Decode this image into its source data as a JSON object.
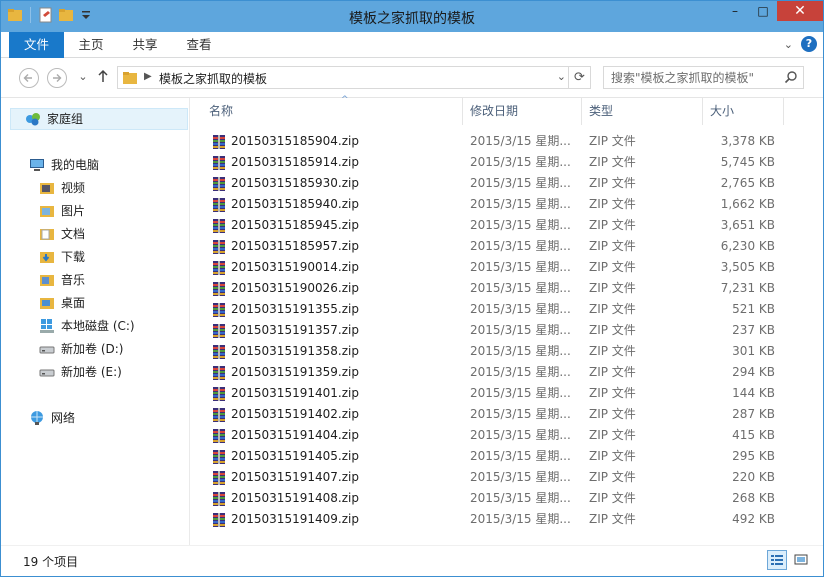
{
  "window": {
    "title": "模板之家抓取的模板",
    "minimize": "–",
    "maximize": "□",
    "close": "✕"
  },
  "ribbon": {
    "tabs": [
      {
        "label": "文件"
      },
      {
        "label": "主页"
      },
      {
        "label": "共享"
      },
      {
        "label": "查看"
      }
    ],
    "help": "?"
  },
  "address": {
    "path": "模板之家抓取的模板"
  },
  "search": {
    "placeholder": "搜索\"模板之家抓取的模板\""
  },
  "nav": {
    "homegroup": "家庭组",
    "computer": "我的电脑",
    "items": [
      {
        "label": "视频",
        "icon": "video-folder-icon"
      },
      {
        "label": "图片",
        "icon": "pictures-folder-icon"
      },
      {
        "label": "文档",
        "icon": "documents-folder-icon"
      },
      {
        "label": "下载",
        "icon": "downloads-folder-icon"
      },
      {
        "label": "音乐",
        "icon": "music-folder-icon"
      },
      {
        "label": "桌面",
        "icon": "desktop-folder-icon"
      },
      {
        "label": "本地磁盘 (C:)",
        "icon": "system-drive-icon"
      },
      {
        "label": "新加卷 (D:)",
        "icon": "drive-icon"
      },
      {
        "label": "新加卷 (E:)",
        "icon": "drive-icon"
      }
    ],
    "network": "网络"
  },
  "columns": {
    "name": "名称",
    "date": "修改日期",
    "type": "类型",
    "size": "大小"
  },
  "files": [
    {
      "name": "20150315185904.zip",
      "date": "2015/3/15 星期...",
      "type": "ZIP 文件",
      "size": "3,378 KB"
    },
    {
      "name": "20150315185914.zip",
      "date": "2015/3/15 星期...",
      "type": "ZIP 文件",
      "size": "5,745 KB"
    },
    {
      "name": "20150315185930.zip",
      "date": "2015/3/15 星期...",
      "type": "ZIP 文件",
      "size": "2,765 KB"
    },
    {
      "name": "20150315185940.zip",
      "date": "2015/3/15 星期...",
      "type": "ZIP 文件",
      "size": "1,662 KB"
    },
    {
      "name": "20150315185945.zip",
      "date": "2015/3/15 星期...",
      "type": "ZIP 文件",
      "size": "3,651 KB"
    },
    {
      "name": "20150315185957.zip",
      "date": "2015/3/15 星期...",
      "type": "ZIP 文件",
      "size": "6,230 KB"
    },
    {
      "name": "20150315190014.zip",
      "date": "2015/3/15 星期...",
      "type": "ZIP 文件",
      "size": "3,505 KB"
    },
    {
      "name": "20150315190026.zip",
      "date": "2015/3/15 星期...",
      "type": "ZIP 文件",
      "size": "7,231 KB"
    },
    {
      "name": "20150315191355.zip",
      "date": "2015/3/15 星期...",
      "type": "ZIP 文件",
      "size": "521 KB"
    },
    {
      "name": "20150315191357.zip",
      "date": "2015/3/15 星期...",
      "type": "ZIP 文件",
      "size": "237 KB"
    },
    {
      "name": "20150315191358.zip",
      "date": "2015/3/15 星期...",
      "type": "ZIP 文件",
      "size": "301 KB"
    },
    {
      "name": "20150315191359.zip",
      "date": "2015/3/15 星期...",
      "type": "ZIP 文件",
      "size": "294 KB"
    },
    {
      "name": "20150315191401.zip",
      "date": "2015/3/15 星期...",
      "type": "ZIP 文件",
      "size": "144 KB"
    },
    {
      "name": "20150315191402.zip",
      "date": "2015/3/15 星期...",
      "type": "ZIP 文件",
      "size": "287 KB"
    },
    {
      "name": "20150315191404.zip",
      "date": "2015/3/15 星期...",
      "type": "ZIP 文件",
      "size": "415 KB"
    },
    {
      "name": "20150315191405.zip",
      "date": "2015/3/15 星期...",
      "type": "ZIP 文件",
      "size": "295 KB"
    },
    {
      "name": "20150315191407.zip",
      "date": "2015/3/15 星期...",
      "type": "ZIP 文件",
      "size": "220 KB"
    },
    {
      "name": "20150315191408.zip",
      "date": "2015/3/15 星期...",
      "type": "ZIP 文件",
      "size": "268 KB"
    },
    {
      "name": "20150315191409.zip",
      "date": "2015/3/15 星期...",
      "type": "ZIP 文件",
      "size": "492 KB"
    }
  ],
  "status": {
    "count": "19 个项目"
  },
  "colors": {
    "accent": "#1979ca",
    "titlebar": "#5ea6dd",
    "close": "#c7423a"
  }
}
